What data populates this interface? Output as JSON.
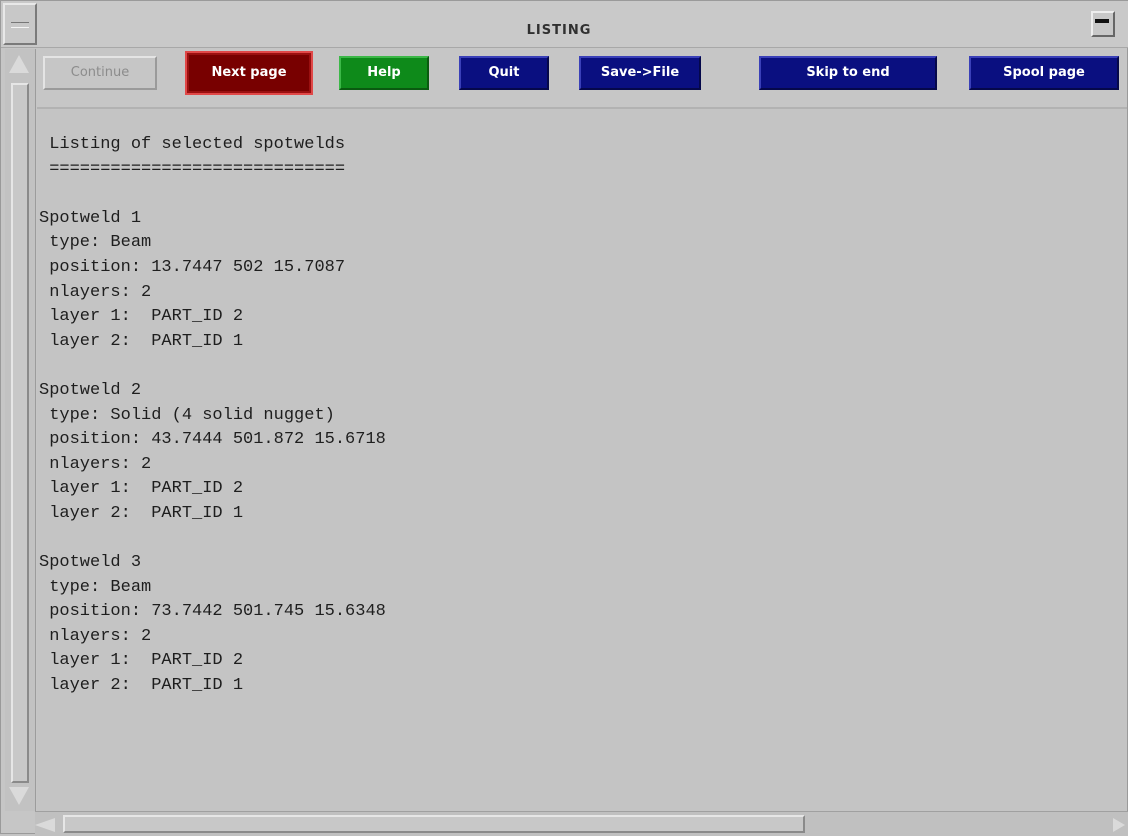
{
  "window": {
    "title": "LISTING"
  },
  "toolbar": {
    "continue_label": "Continue",
    "next_page_label": "Next page",
    "help_label": "Help",
    "quit_label": "Quit",
    "save_label": "Save->File",
    "skip_label": "Skip to end",
    "spool_label": "Spool page"
  },
  "listing": {
    "lines": [
      " Listing of selected spotwelds",
      " =============================",
      "",
      "Spotweld 1",
      " type: Beam",
      " position: 13.7447 502 15.7087",
      " nlayers: 2",
      " layer 1:  PART_ID 2",
      " layer 2:  PART_ID 1",
      "",
      "Spotweld 2",
      " type: Solid (4 solid nugget)",
      " position: 43.7444 501.872 15.6718",
      " nlayers: 2",
      " layer 1:  PART_ID 2",
      " layer 2:  PART_ID 1",
      "",
      "Spotweld 3",
      " type: Beam",
      " position: 73.7442 501.745 15.6348",
      " nlayers: 2",
      " layer 1:  PART_ID 2",
      " layer 2:  PART_ID 1"
    ]
  },
  "icons": {
    "system_menu": "system-menu-icon",
    "minimize": "minimize-icon",
    "scroll_up": "arrow-up-icon",
    "scroll_down": "arrow-down-icon",
    "scroll_left": "arrow-left-icon",
    "scroll_right": "arrow-right-icon"
  },
  "colors": {
    "next_page": "#780000",
    "help": "#0e8a1a",
    "action_blue": "#0a0f80",
    "background": "#c4c4c4"
  }
}
